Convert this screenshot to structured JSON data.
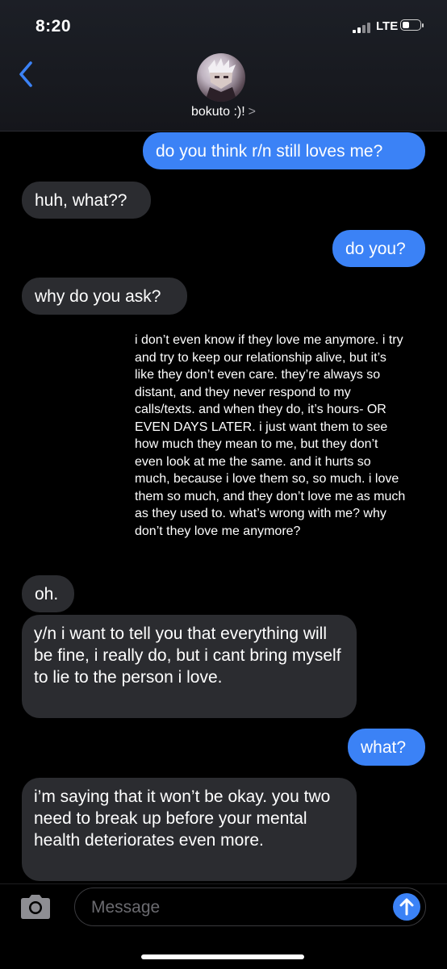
{
  "status_bar": {
    "time": "8:20",
    "network": "LTE",
    "signal_icon": "signal-bars-icon",
    "battery_icon": "battery-icon"
  },
  "header": {
    "contact_name": "bokuto :)!",
    "chevron": ">",
    "back_icon": "chevron-left-icon"
  },
  "messages": [
    {
      "from": "me",
      "text": "do you think r/n still loves me?"
    },
    {
      "from": "them",
      "text": "huh, what??"
    },
    {
      "from": "me",
      "text": "do you?"
    },
    {
      "from": "them",
      "text": "why do you ask?"
    },
    {
      "from": "me",
      "text": "i don’t even know if they love me anymore. i try and try to keep our relationship alive, but it’s like they don’t even care. they’re always so distant, and they never respond to my calls/texts. and when they do, it’s hours- OR EVEN DAYS LATER. i just want them to see how much they mean to me, but they don’t even look at me the same. and it hurts so much, because i love them so, so much. i love them so much, and they don’t love me as much as they used to. what’s wrong with me? why don’t they love me anymore?"
    },
    {
      "from": "them",
      "text": "oh."
    },
    {
      "from": "them",
      "text": "y/n i want to tell you that everything will be fine, i really do, but i cant bring myself to lie to the person i love."
    },
    {
      "from": "me",
      "text": "what?"
    },
    {
      "from": "them",
      "text": "i’m saying that it won’t be okay. you two need to break up before your mental health deteriorates even more."
    }
  ],
  "composer": {
    "placeholder": "Message",
    "camera_icon": "camera-icon",
    "send_icon": "send-arrow-icon"
  },
  "colors": {
    "outgoing_bubble": "#3b82f6",
    "incoming_bubble": "#2b2c30",
    "background": "#000000"
  }
}
